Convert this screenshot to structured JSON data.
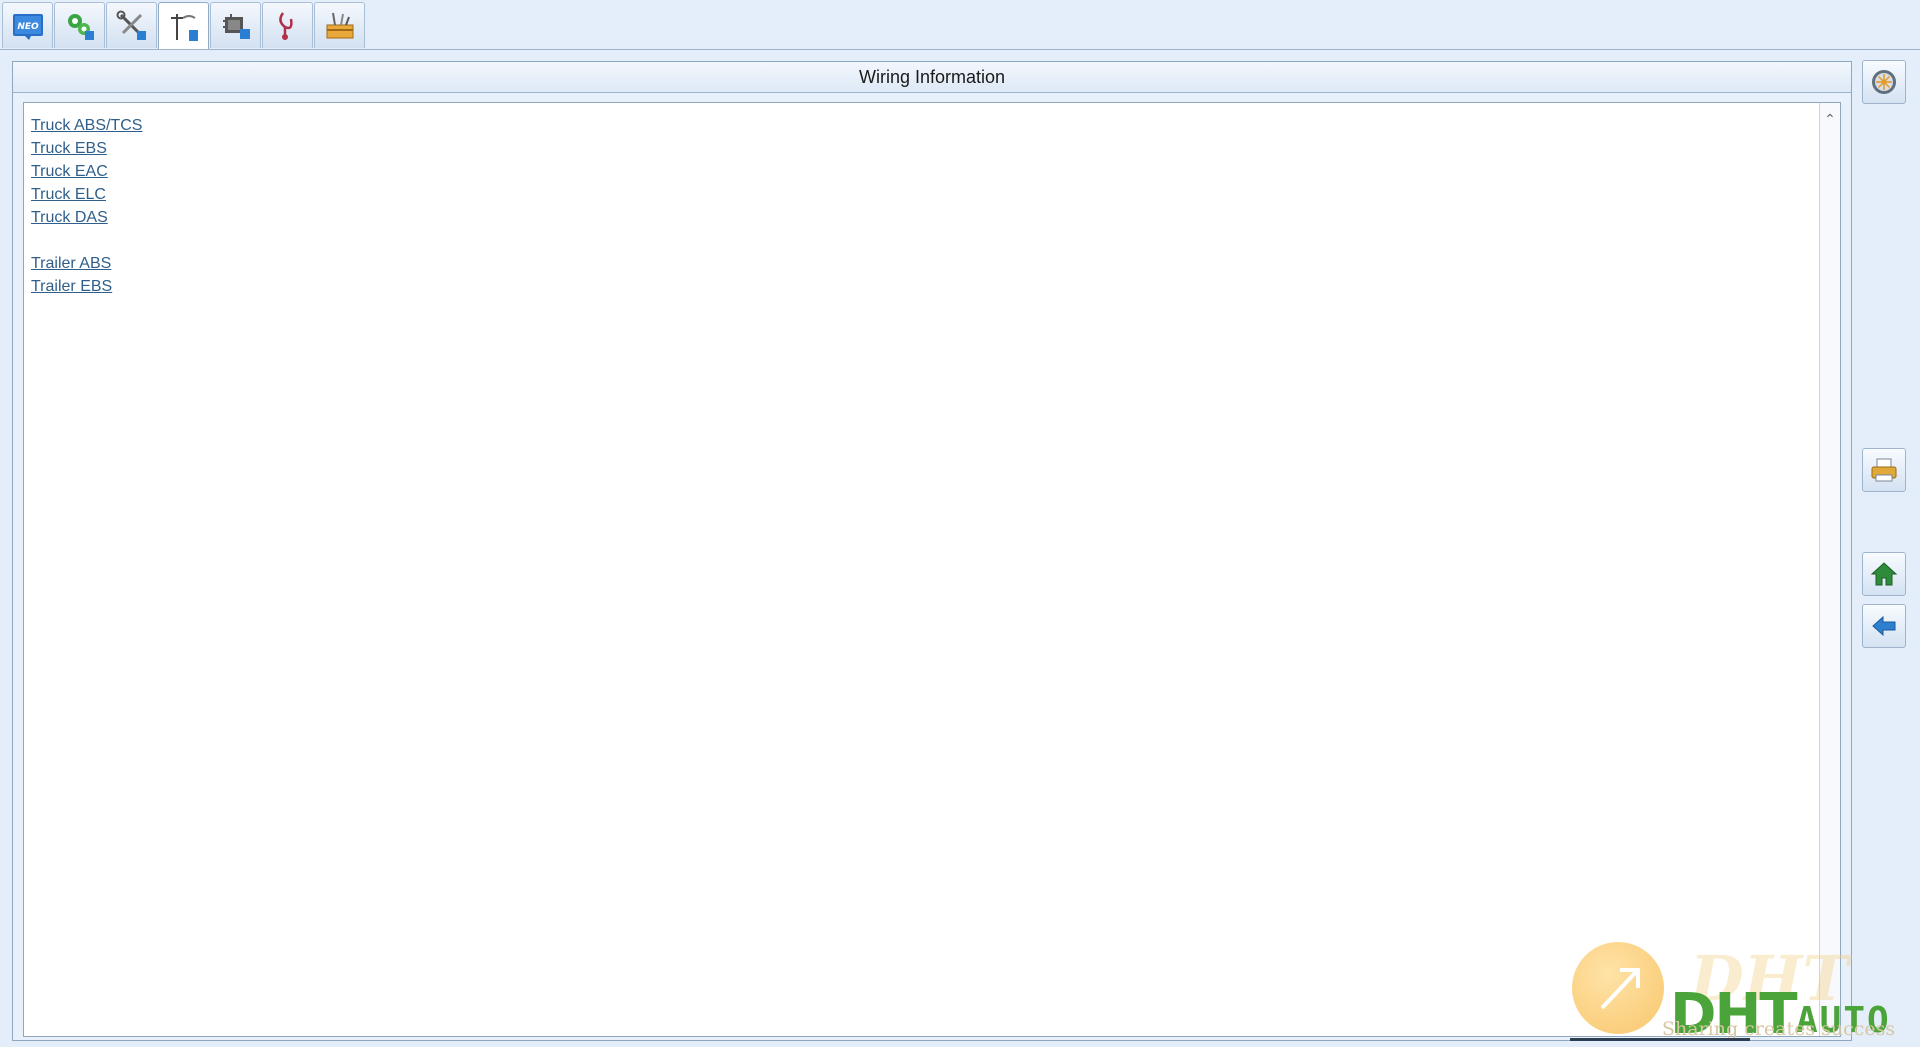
{
  "toolbar": {
    "tabs": [
      {
        "id": "neo",
        "icon": "neo-logo-icon",
        "text": "NEO",
        "active": false
      },
      {
        "id": "system-diagnostics",
        "icon": "gears-icon",
        "active": false
      },
      {
        "id": "tools",
        "icon": "wrench-screwdriver-icon",
        "active": false
      },
      {
        "id": "wiring",
        "icon": "wiring-tool-icon",
        "active": true
      },
      {
        "id": "ecu",
        "icon": "ecu-module-icon",
        "active": false
      },
      {
        "id": "test",
        "icon": "stethoscope-icon",
        "active": false
      },
      {
        "id": "toolbox",
        "icon": "toolbox-icon",
        "active": false
      }
    ]
  },
  "panel": {
    "title": "Wiring Information",
    "truck_links": [
      "Truck ABS/TCS",
      "Truck EBS",
      "Truck EAC",
      "Truck ELC",
      "Truck DAS"
    ],
    "trailer_links": [
      "Trailer ABS",
      "Trailer EBS"
    ]
  },
  "side_buttons": [
    {
      "id": "wheel",
      "icon": "wheel-icon"
    },
    {
      "id": "print",
      "icon": "printer-icon"
    },
    {
      "id": "home",
      "icon": "home-icon"
    },
    {
      "id": "back",
      "icon": "back-arrow-icon"
    }
  ],
  "watermark": {
    "brand": "DHT",
    "suffix": "AUTO",
    "tagline": "Sharing creates success"
  },
  "colors": {
    "background": "#e3eefa",
    "link": "#2f5f8a",
    "home_icon": "#2e8b3a",
    "back_icon": "#2f7fd0",
    "watermark_green": "#4aa43a",
    "watermark_orange": "#f6b43c"
  }
}
